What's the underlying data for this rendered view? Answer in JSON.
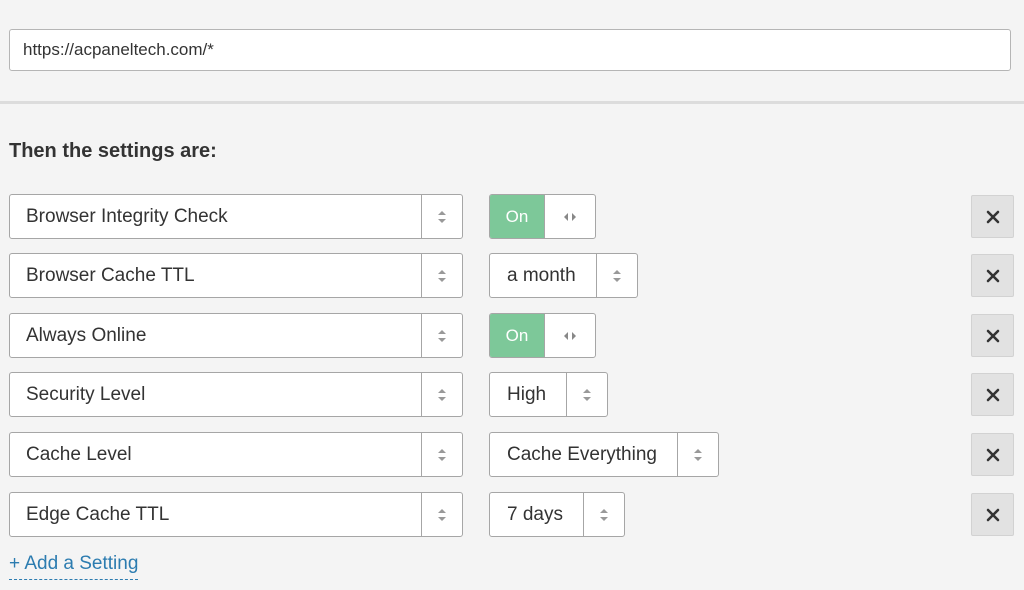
{
  "url_pattern": {
    "value": "https://acpaneltech.com/*"
  },
  "settings_heading": "Then the settings are:",
  "settings": [
    {
      "name": "Browser Integrity Check",
      "control": "toggle",
      "value": "On"
    },
    {
      "name": "Browser Cache TTL",
      "control": "select",
      "value": "a month"
    },
    {
      "name": "Always Online",
      "control": "toggle",
      "value": "On"
    },
    {
      "name": "Security Level",
      "control": "select",
      "value": "High"
    },
    {
      "name": "Cache Level",
      "control": "select",
      "value": "Cache Everything"
    },
    {
      "name": "Edge Cache TTL",
      "control": "select",
      "value": "7 days"
    }
  ],
  "add_setting_label": "+ Add a Setting",
  "icons": {
    "stepper": "up-down-chevron-icon",
    "toggle_handle": "left-right-arrows-icon",
    "remove": "close-icon"
  },
  "colors": {
    "toggle_on": "#7dc899",
    "link": "#2c7cb0",
    "background": "#f4f4f4"
  }
}
